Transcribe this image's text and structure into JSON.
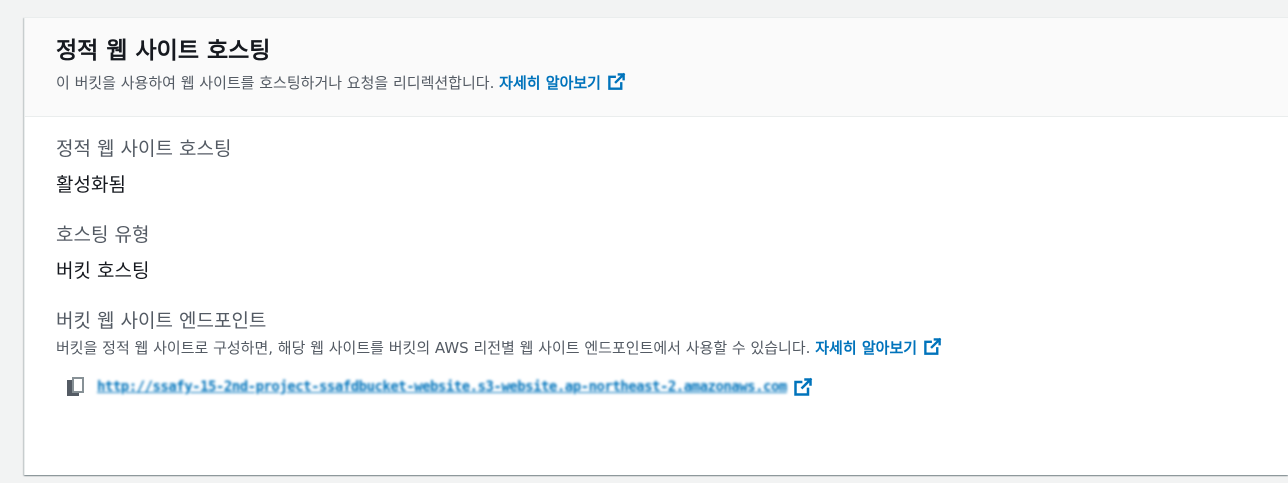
{
  "header": {
    "title": "정적 웹 사이트 호스팅",
    "description": "이 버킷을 사용하여 웹 사이트를 호스팅하거나 요청을 리디렉션합니다.",
    "learn_more": "자세히 알아보기"
  },
  "fields": {
    "hosting": {
      "label": "정적 웹 사이트 호스팅",
      "value": "활성화됨"
    },
    "hosting_type": {
      "label": "호스팅 유형",
      "value": "버킷 호스팅"
    },
    "endpoint": {
      "label": "버킷 웹 사이트 엔드포인트",
      "hint": "버킷을 정적 웹 사이트로 구성하면, 해당 웹 사이트를 버킷의 AWS 리전별 웹 사이트 엔드포인트에서 사용할 수 있습니다.",
      "learn_more": "자세히 알아보기",
      "url": "http://ssafy-15-2nd-project-ssafdbucket-website.s3-website.ap-northeast-2.amazonaws.com"
    }
  },
  "icons": {
    "external_link": "external-link-icon",
    "copy": "copy-icon"
  },
  "colors": {
    "link": "#0073bb",
    "text_secondary": "#545b64",
    "text_primary": "#16191f",
    "header_bg": "#fafafa"
  }
}
